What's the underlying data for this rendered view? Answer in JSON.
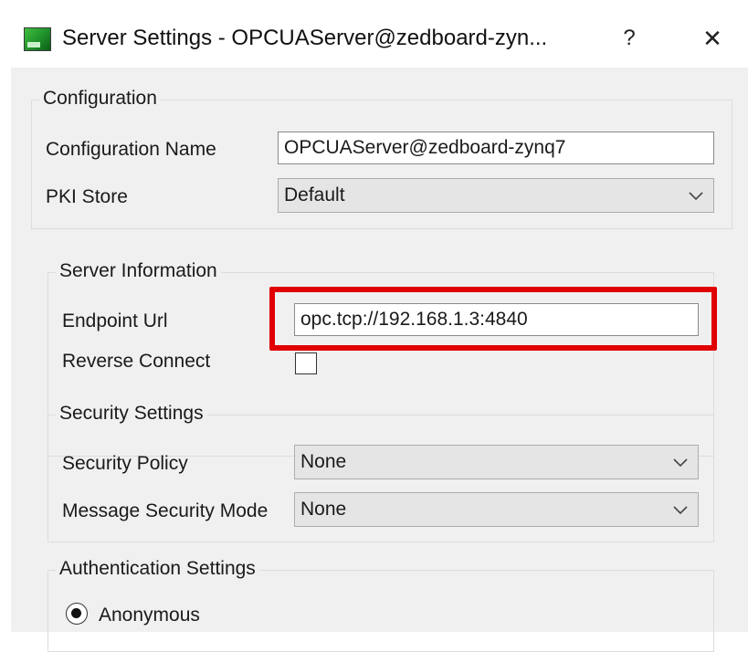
{
  "window": {
    "title": "Server Settings - OPCUAServer@zedboard-zyn...",
    "help_label": "?",
    "close_label": "✕"
  },
  "configuration": {
    "group_label": "Configuration",
    "name_label": "Configuration Name",
    "name_value": "OPCUAServer@zedboard-zynq7",
    "pki_label": "PKI Store",
    "pki_value": "Default"
  },
  "server_info": {
    "group_label": "Server Information",
    "endpoint_label": "Endpoint Url",
    "endpoint_value": "opc.tcp://192.168.1.3:4840",
    "reverse_label": "Reverse Connect",
    "reverse_checked": false
  },
  "security": {
    "group_label": "Security Settings",
    "policy_label": "Security Policy",
    "policy_value": "None",
    "mode_label": "Message Security Mode",
    "mode_value": "None"
  },
  "authentication": {
    "group_label": "Authentication Settings",
    "anonymous_label": "Anonymous",
    "anonymous_selected": true
  },
  "colors": {
    "highlight": "#e00000",
    "dialog_bg": "#f0f0f0"
  }
}
